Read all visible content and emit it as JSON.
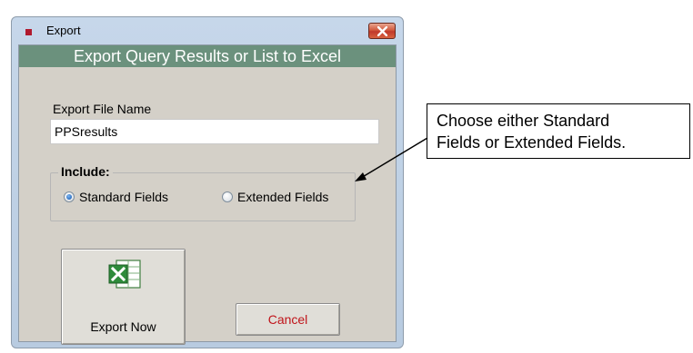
{
  "window": {
    "title": "Export",
    "banner": "Export Query Results or List to Excel"
  },
  "form": {
    "filename_label": "Export File Name",
    "filename_value": "PPSresults",
    "include_label": "Include:",
    "options": [
      {
        "label": "Standard Fields",
        "selected": true
      },
      {
        "label": "Extended Fields",
        "selected": false
      }
    ]
  },
  "buttons": {
    "export_label": "Export Now",
    "cancel_label": "Cancel"
  },
  "callout": {
    "line1": "Choose either Standard",
    "line2": "Fields or Extended Fields."
  },
  "colors": {
    "banner": "#6b917d",
    "cancel_text": "#c0141a",
    "title_bullet": "#b01a2e"
  },
  "icons": {
    "close": "close-icon",
    "excel": "excel-icon"
  }
}
